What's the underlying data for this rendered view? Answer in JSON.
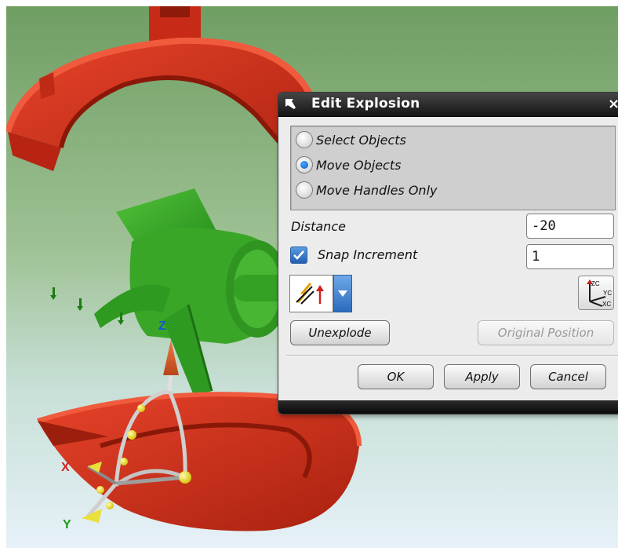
{
  "dialog": {
    "title": "Edit Explosion",
    "close_glyph": "×",
    "mode_options": [
      {
        "label": "Select Objects",
        "selected": false
      },
      {
        "label": "Move Objects",
        "selected": true
      },
      {
        "label": "Move Handles Only",
        "selected": false
      }
    ],
    "distance_label": "Distance",
    "distance_value": "-20",
    "snap_label": "Snap Increment",
    "snap_checked": true,
    "snap_value": "1",
    "unexplode_label": "Unexplode",
    "original_position_label": "Original Position",
    "ok_label": "OK",
    "apply_label": "Apply",
    "cancel_label": "Cancel"
  },
  "viewport": {
    "axis_labels": {
      "x": "X",
      "y": "Y",
      "z": "Z"
    },
    "csys_icon_labels": {
      "zc": "ZC",
      "yc": "YC",
      "xc": "XC"
    },
    "colors": {
      "background_top": "#6f9e63",
      "background_bottom": "#e6f1f8",
      "part_red": "#d8321c",
      "part_green": "#3aa628",
      "handle_yellow": "#f0e000",
      "accent_blue": "#1f66c2"
    },
    "icons": [
      "pin-icon",
      "close-icon",
      "method-icon",
      "dropdown-arrow-icon",
      "csys-icon",
      "checkmark-icon"
    ]
  }
}
